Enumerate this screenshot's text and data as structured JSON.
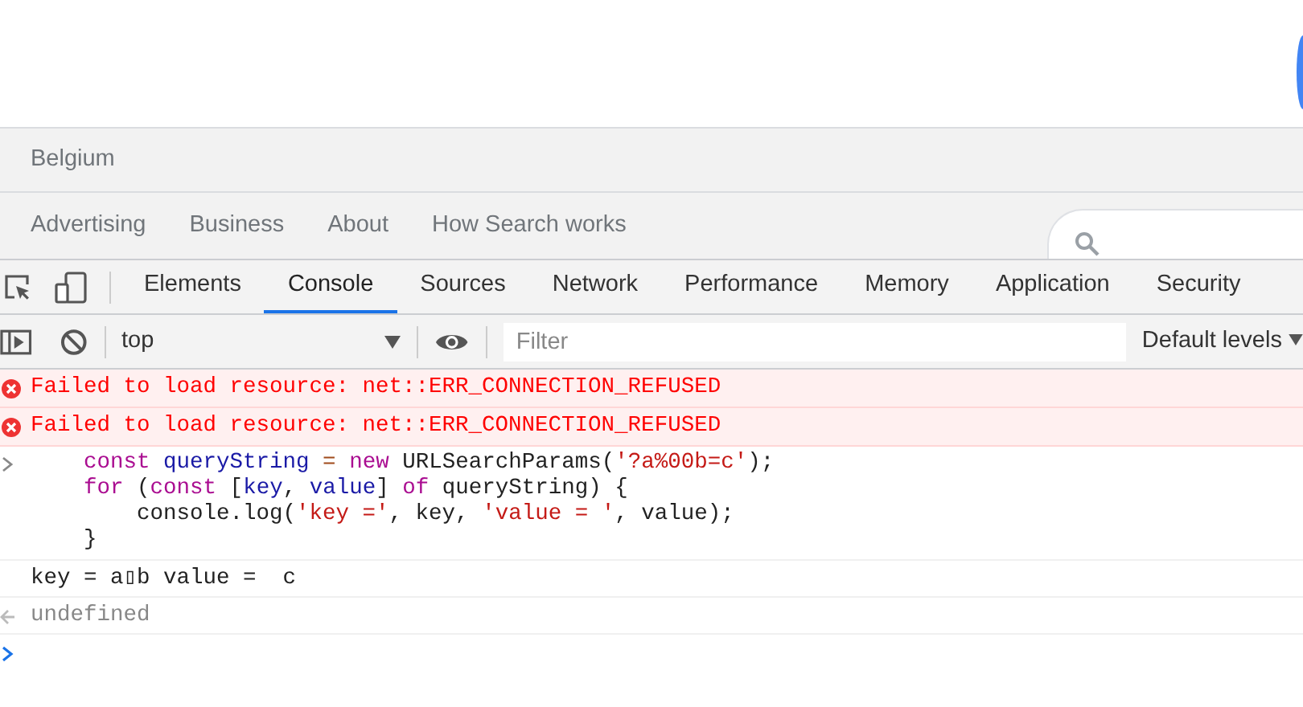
{
  "page": {
    "footer_region": "Belgium",
    "footer_links": [
      "Advertising",
      "Business",
      "About",
      "How Search works"
    ]
  },
  "devtools": {
    "tabs": [
      {
        "label": "Elements",
        "selected": false
      },
      {
        "label": "Console",
        "selected": true
      },
      {
        "label": "Sources",
        "selected": false
      },
      {
        "label": "Network",
        "selected": false
      },
      {
        "label": "Performance",
        "selected": false
      },
      {
        "label": "Memory",
        "selected": false
      },
      {
        "label": "Application",
        "selected": false
      },
      {
        "label": "Security",
        "selected": false
      }
    ],
    "toolbar": {
      "context": "top",
      "filter_placeholder": "Filter",
      "levels": "Default levels"
    },
    "console": [
      {
        "kind": "error",
        "text": "Failed to load resource: net::ERR_CONNECTION_REFUSED"
      },
      {
        "kind": "error",
        "text": "Failed to load resource: net::ERR_CONNECTION_REFUSED"
      },
      {
        "kind": "input",
        "lines": [
          [
            {
              "text": "    const",
              "kind": "keyword"
            },
            {
              "text": " queryString",
              "kind": "variable"
            },
            {
              "text": " =",
              "kind": "operator"
            },
            {
              "text": " new",
              "kind": "keyword"
            },
            {
              "text": " URLSearchParams(",
              "kind": "plain"
            },
            {
              "text": "'?a%00b=c'",
              "kind": "string"
            },
            {
              "text": ");",
              "kind": "plain"
            }
          ],
          [
            {
              "text": "    for",
              "kind": "keyword"
            },
            {
              "text": " (",
              "kind": "plain"
            },
            {
              "text": "const",
              "kind": "keyword"
            },
            {
              "text": " [",
              "kind": "plain"
            },
            {
              "text": "key",
              "kind": "variable"
            },
            {
              "text": ", ",
              "kind": "plain"
            },
            {
              "text": "value",
              "kind": "variable"
            },
            {
              "text": "] ",
              "kind": "plain"
            },
            {
              "text": "of",
              "kind": "keyword"
            },
            {
              "text": " queryString) {",
              "kind": "plain"
            }
          ],
          [
            {
              "text": "        console.log(",
              "kind": "plain"
            },
            {
              "text": "'key ='",
              "kind": "string"
            },
            {
              "text": ", key, ",
              "kind": "plain"
            },
            {
              "text": "'value = '",
              "kind": "string"
            },
            {
              "text": ", value);",
              "kind": "plain"
            }
          ],
          [
            {
              "text": "    }",
              "kind": "plain"
            }
          ]
        ]
      },
      {
        "kind": "log",
        "text": "key = a▯b value =  c"
      },
      {
        "kind": "result",
        "text": "undefined"
      },
      {
        "kind": "prompt"
      }
    ]
  }
}
